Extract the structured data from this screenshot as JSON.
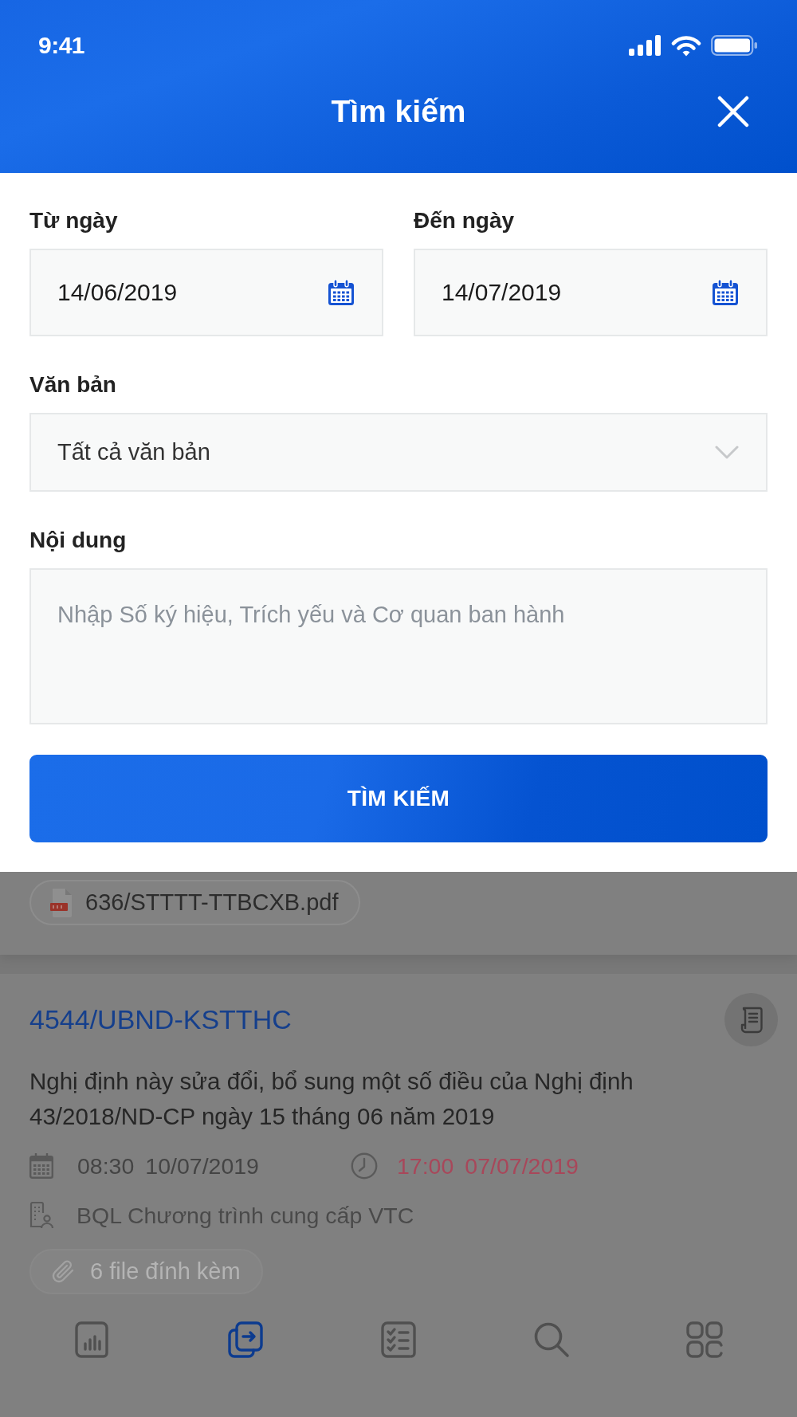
{
  "status_bar": {
    "time": "9:41"
  },
  "header": {
    "title": "Tìm kiếm"
  },
  "search_form": {
    "date_fields": [
      {
        "label": "Từ ngày",
        "value": "14/06/2019"
      },
      {
        "label": "Đến ngày",
        "value": "14/07/2019"
      }
    ],
    "document_type": {
      "label": "Văn bản",
      "value": "Tất cả văn bản"
    },
    "content": {
      "label": "Nội dung",
      "placeholder": "Nhập Số ký hiệu, Trích yếu và Cơ quan ban hành"
    },
    "submit_button": "TÌM KIẾM"
  },
  "document_list": {
    "previous_attachment": "636/STTTT-TTBCXB.pdf",
    "document": {
      "number": "4544/UBND-KSTTHC",
      "summary": "Nghị định này sửa đổi, bổ sung một số điều của Nghị định 43/2018/ND-CP ngày 15 tháng 06 năm 2019",
      "received": {
        "time": "08:30",
        "date": "10/07/2019"
      },
      "deadline": {
        "time": "17:00",
        "date": "07/07/2019",
        "overdue": true
      },
      "agency": "BQL Chương trình cung cấp VTC",
      "attachments": "6 file đính kèm"
    }
  },
  "bottom_nav": [
    {
      "selected": false
    },
    {
      "selected": true
    },
    {
      "selected": false
    },
    {
      "selected": false
    },
    {
      "selected": false
    }
  ]
}
